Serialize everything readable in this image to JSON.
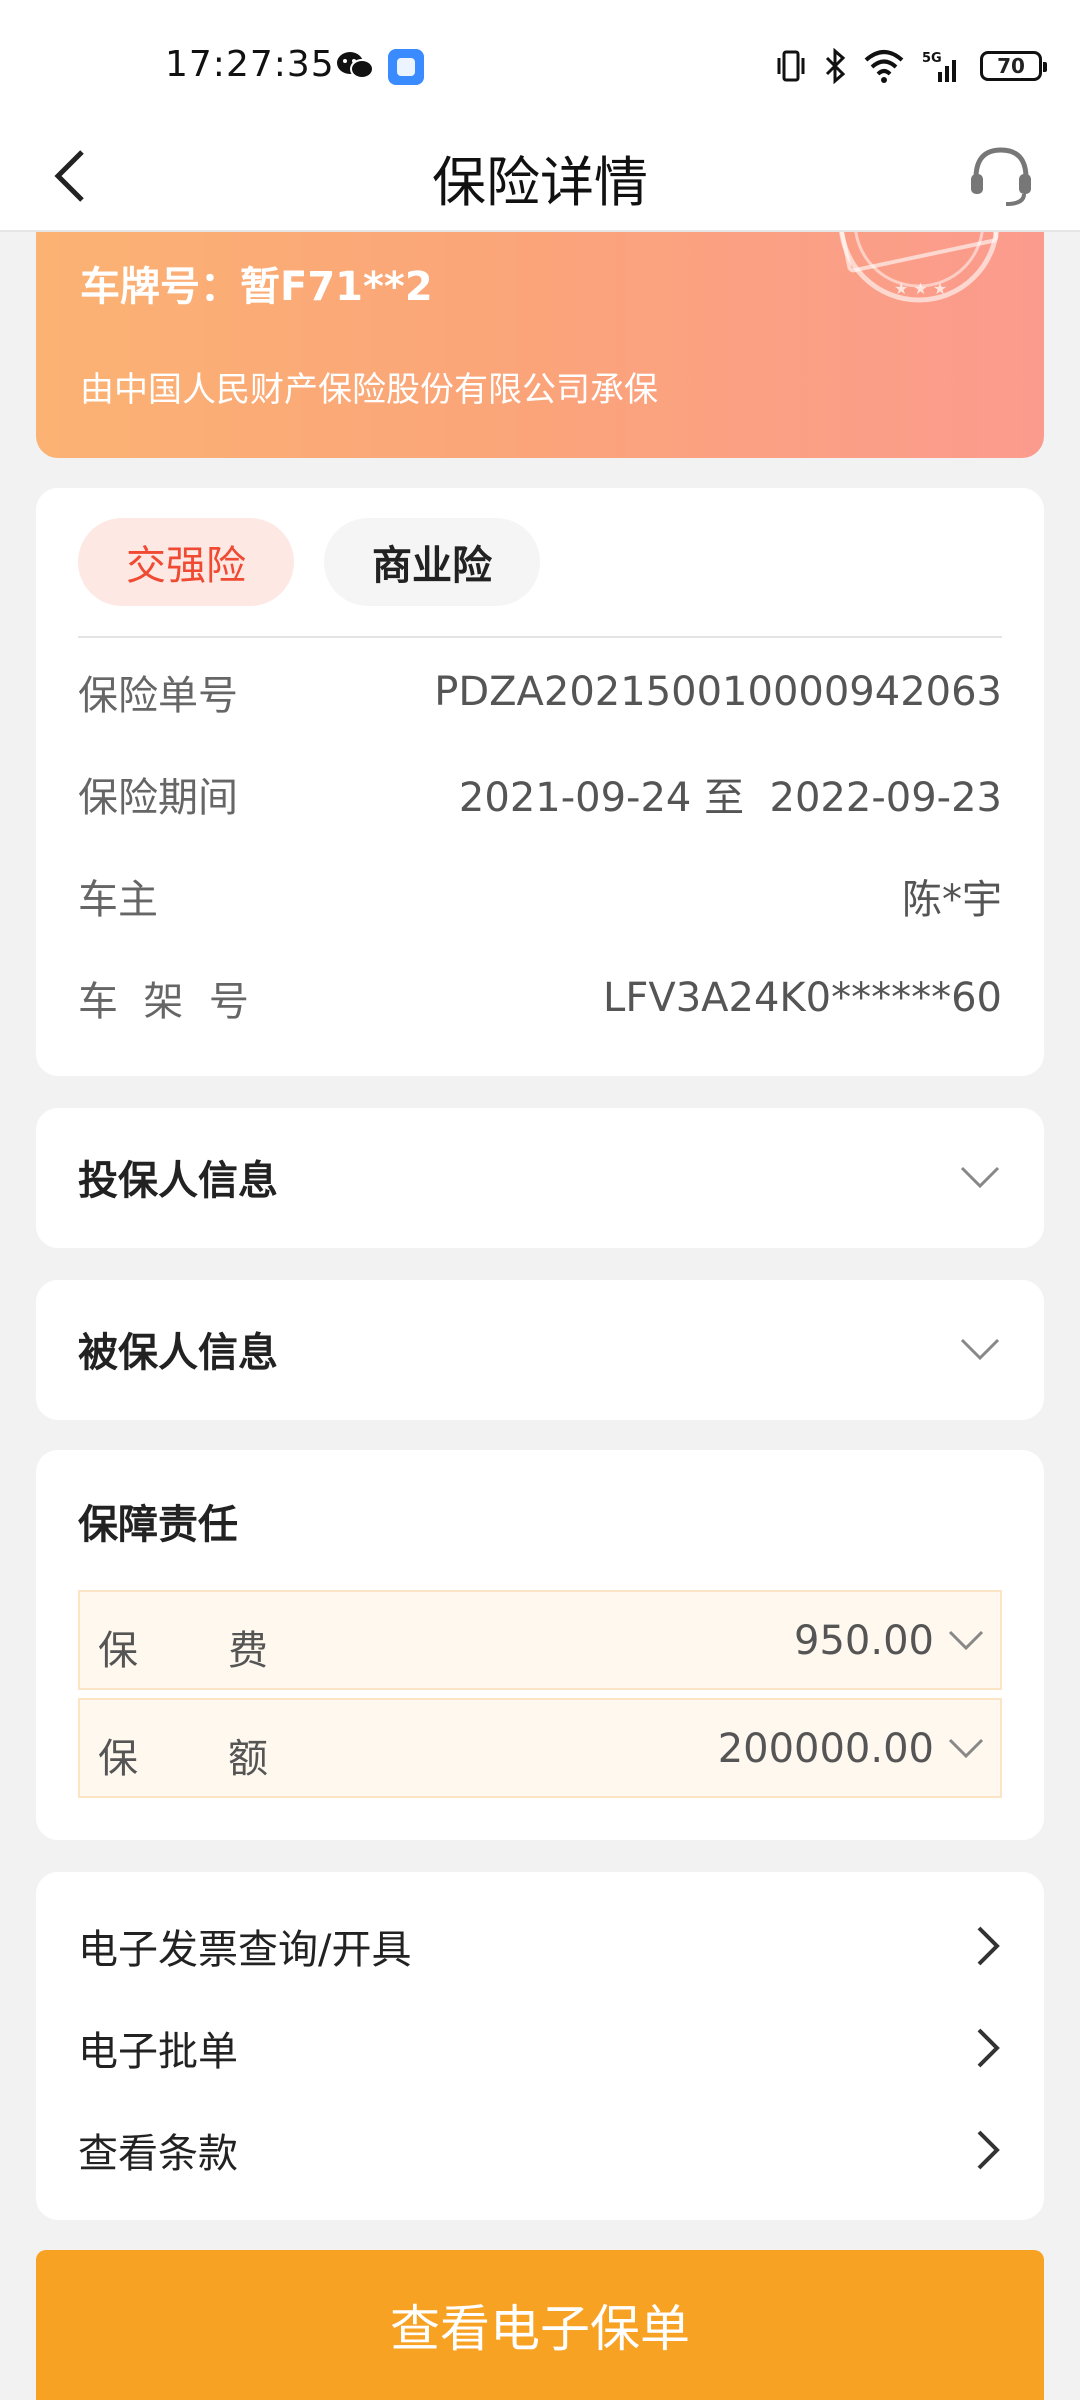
{
  "status_bar": {
    "time": "17:27:35",
    "battery": "70",
    "network": "5G",
    "icons": [
      "wechat-icon",
      "app-notification-icon",
      "vibrate-icon",
      "bluetooth-icon",
      "wifi-icon",
      "signal-icon",
      "battery-icon"
    ]
  },
  "header": {
    "title": "保险详情",
    "back_icon": "chevron-left-icon",
    "service_icon": "headset-icon"
  },
  "banner": {
    "plate": "车牌号：暂F71**2",
    "insurer": "由中国人民财产保险股份有限公司承保",
    "colors": {
      "start": "#fbb273",
      "end": "#fb9b8e"
    }
  },
  "policy": {
    "tabs": [
      {
        "label": "交强险",
        "active": true
      },
      {
        "label": "商业险",
        "active": false
      }
    ],
    "rows": [
      {
        "key": "保险单号",
        "value": "PDZA202150010000942063"
      },
      {
        "key": "保险期间",
        "value": "2021-09-24 至  2022-09-23"
      },
      {
        "key": "车主",
        "value": "陈*宇"
      },
      {
        "key": "车  架  号",
        "value": "LFV3A24K0******60"
      }
    ]
  },
  "sections": {
    "applicant": "投保人信息",
    "insured": "被保人信息"
  },
  "coverage": {
    "title": "保障责任",
    "items": [
      {
        "label_a": "保",
        "label_b": "费",
        "value": "950.00"
      },
      {
        "label_a": "保",
        "label_b": "额",
        "value": "200000.00"
      }
    ]
  },
  "links": [
    {
      "label": "电子发票查询/开具"
    },
    {
      "label": "电子批单"
    },
    {
      "label": "查看条款"
    }
  ],
  "primary_button": {
    "label": "查看电子保单",
    "color": "#f8a224"
  },
  "accent": "#f04a33"
}
